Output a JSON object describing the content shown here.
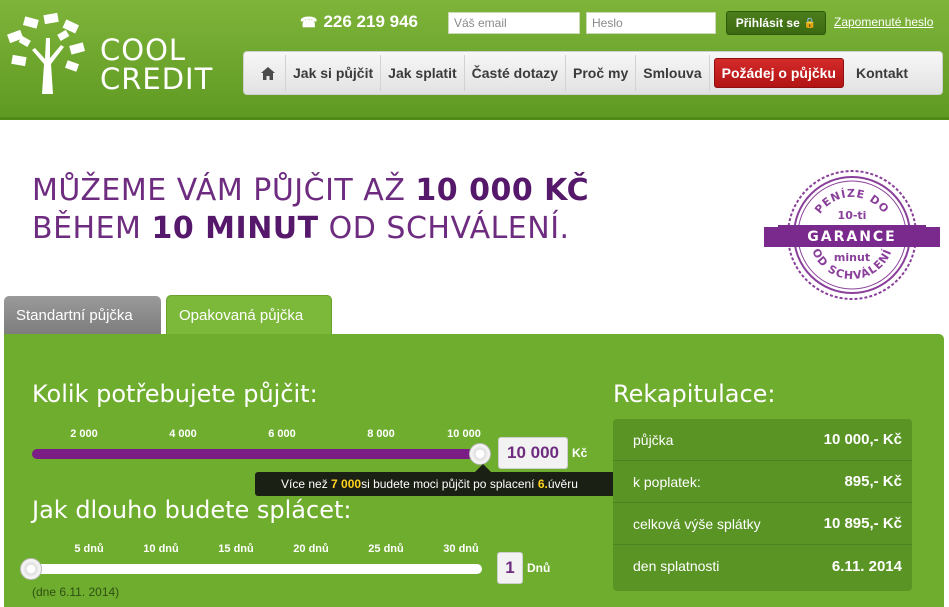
{
  "header": {
    "logo_line1": "COOL",
    "logo_line2": "CREDIT",
    "phone": "226 219 946",
    "email_placeholder": "Váš email",
    "password_placeholder": "Heslo",
    "login_label": "Přihlásit se",
    "forgot_label": "Zapomenuté heslo"
  },
  "nav": {
    "items": [
      "Jak si půjčit",
      "Jak splatit",
      "Časté dotazy",
      "Proč my",
      "Smlouva",
      "Požádej o půjčku",
      "Kontakt"
    ]
  },
  "headline": {
    "line1_pre": "MŮŽEME VÁM PŮJČIT AŽ ",
    "line1_bold": "10 000 KČ",
    "line2_pre": "BĚHEM ",
    "line2_bold": "10 MINUT",
    "line2_post": " OD SCHVÁLENÍ."
  },
  "stamp": {
    "top": "PENÍZE DO",
    "number": "10-ti",
    "band": "GARANCE",
    "unit": "minut",
    "bottom": "OD SCHVÁLENÍ"
  },
  "tabs": [
    "Standartní půjčka",
    "Opakovaná půjčka"
  ],
  "loan": {
    "heading": "Kolik potřebujete půjčit:",
    "ticks": [
      "2 000",
      "4 000",
      "6 000",
      "8 000",
      "10 000"
    ],
    "value": "10 000",
    "unit": "Kč",
    "level": 1.0,
    "tooltip_pre": "Více než ",
    "tooltip_amount": "7 000",
    "tooltip_mid": " si budete moci půjčit po splacení ",
    "tooltip_count": "6.",
    "tooltip_post": " úvěru"
  },
  "duration": {
    "heading": "Jak dlouho budete splácet:",
    "ticks": [
      "5 dnů",
      "10 dnů",
      "15 dnů",
      "20 dnů",
      "25 dnů",
      "30 dnů"
    ],
    "value": "1",
    "unit": "Dnů",
    "level": 0.0,
    "date_note": "(dne 6.11. 2014)"
  },
  "summary": {
    "heading": "Rekapitulace:",
    "rows": [
      {
        "label": "půjčka",
        "value": "10 000,- Kč"
      },
      {
        "label": "k poplatek:",
        "value": "895,- Kč"
      },
      {
        "label": "celková výše splátky",
        "value": "10 895,- Kč"
      },
      {
        "label": "den splatnosti",
        "value": "6.11. 2014"
      }
    ]
  },
  "colors": {
    "header_green": "#6aa52a",
    "panel_green": "#6fad2f",
    "purple": "#6d2c7f",
    "cta_red": "#c21f1f"
  }
}
